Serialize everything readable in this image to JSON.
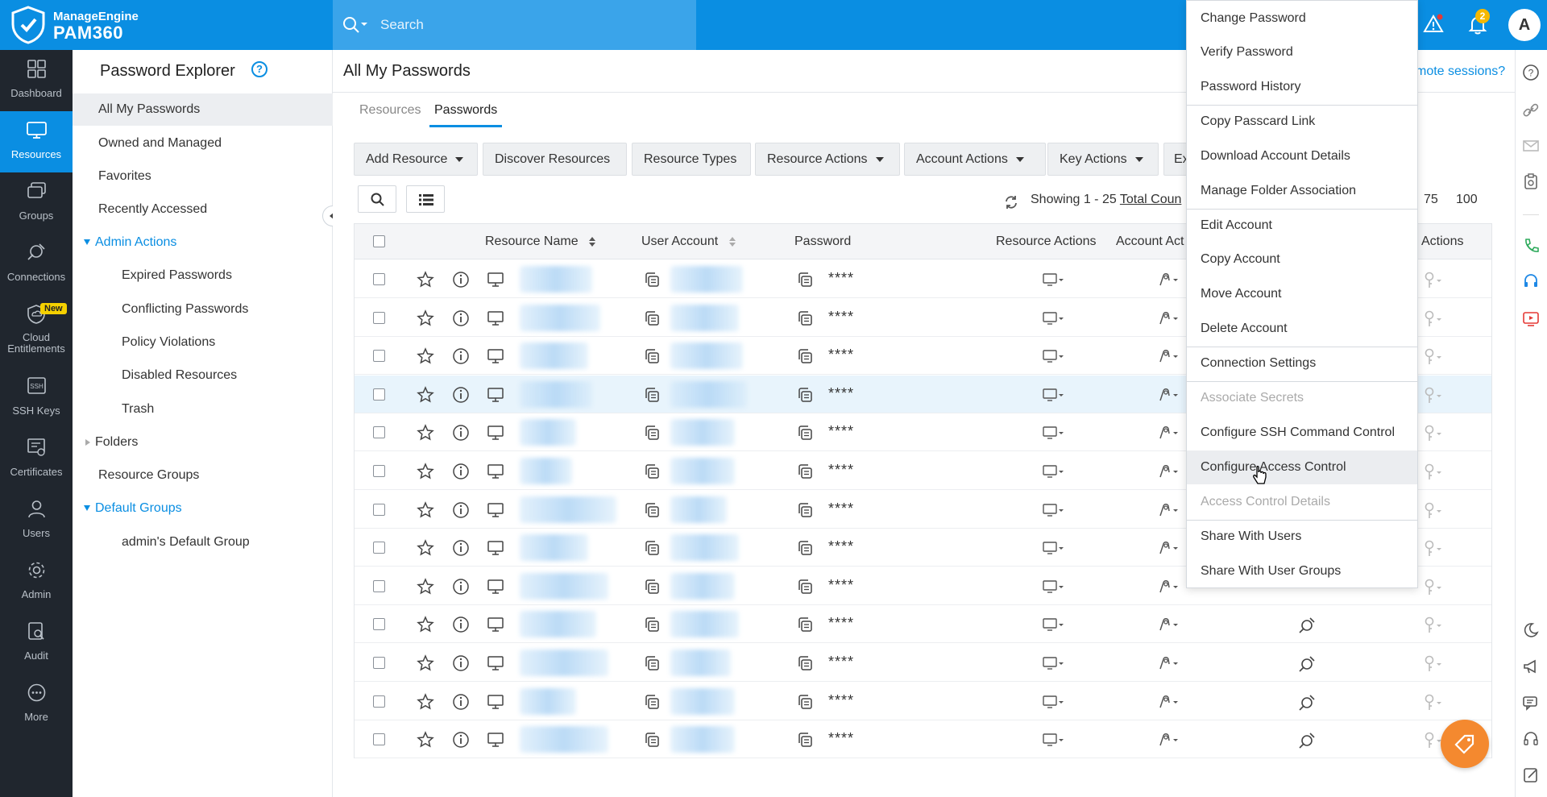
{
  "brand": {
    "line1": "ManageEngine",
    "line2": "PAM360"
  },
  "search": {
    "placeholder": "Search"
  },
  "topbar": {
    "notification_count": "2",
    "avatar_letter": "A"
  },
  "leftnav": [
    {
      "label": "Dashboard",
      "icon": "dashboard-icon"
    },
    {
      "label": "Resources",
      "icon": "monitor-icon",
      "active": true
    },
    {
      "label": "Groups",
      "icon": "groups-icon"
    },
    {
      "label": "Connections",
      "icon": "connections-icon"
    },
    {
      "label": "Cloud Entitlements",
      "icon": "cloud-shield-icon",
      "badge": "New"
    },
    {
      "label": "SSH Keys",
      "icon": "ssh-icon"
    },
    {
      "label": "Certificates",
      "icon": "certificate-icon"
    },
    {
      "label": "Users",
      "icon": "user-icon"
    },
    {
      "label": "Admin",
      "icon": "gear-icon"
    },
    {
      "label": "Audit",
      "icon": "audit-icon"
    },
    {
      "label": "More",
      "icon": "more-icon"
    }
  ],
  "explorer": {
    "title": "Password Explorer",
    "help": "?",
    "items": {
      "all": "All My Passwords",
      "owned": "Owned and Managed",
      "favorites": "Favorites",
      "recent": "Recently Accessed",
      "admin_actions": "Admin Actions",
      "expired": "Expired Passwords",
      "conflicting": "Conflicting Passwords",
      "policy": "Policy Violations",
      "disabled": "Disabled Resources",
      "trash": "Trash",
      "folders": "Folders",
      "resource_groups": "Resource Groups",
      "default_groups": "Default Groups",
      "admin_default": "admin's Default Group"
    }
  },
  "main": {
    "title": "All My Passwords",
    "remote_link": "mote sessions?",
    "tabs": [
      "Resources",
      "Passwords"
    ],
    "toolbar": {
      "add_resource": "Add Resource",
      "discover": "Discover Resources",
      "types": "Resource Types",
      "resource_actions": "Resource Actions",
      "account_actions": "Account Actions",
      "key_actions": "Key Actions",
      "more_partial": "Ex"
    },
    "showing_prefix": "Showing 1 - 25",
    "total_count": "Total Coun",
    "page_sizes": [
      "75",
      "100"
    ],
    "columns": {
      "resource_name": "Resource Name",
      "user_account": "User Account",
      "password": "Password",
      "resource_actions": "Resource Actions",
      "account_actions": "Account Act",
      "actions": "Actions"
    },
    "password_mask": "****",
    "row_count": 13
  },
  "menu": {
    "items": [
      "Change Password",
      "Verify Password",
      "Password History",
      "Copy Passcard Link",
      "Download Account Details",
      "Manage Folder Association",
      "Edit Account",
      "Copy Account",
      "Move Account",
      "Delete Account",
      "Connection Settings",
      "Associate Secrets",
      "Configure SSH Command Control",
      "Configure Access Control",
      "Access Control Details",
      "Share With Users",
      "Share With User Groups"
    ],
    "disabled": [
      "Associate Secrets",
      "Access Control Details"
    ],
    "hovered": "Configure Access Control"
  },
  "colors": {
    "accent": "#0a8ee2",
    "nav_bg": "#20262e",
    "fab": "#f4892f"
  }
}
